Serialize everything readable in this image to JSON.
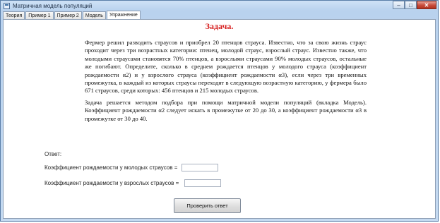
{
  "window": {
    "title": "Матричная модель популяций",
    "minimize_glyph": "–",
    "maximize_glyph": "□",
    "close_glyph": "✕"
  },
  "tabs": [
    {
      "label": "Теория"
    },
    {
      "label": "Пример 1"
    },
    {
      "label": "Пример 2"
    },
    {
      "label": "Модель"
    },
    {
      "label": "Упражнение"
    }
  ],
  "active_tab": "Упражнение",
  "task": {
    "title": "Задача.",
    "paragraph1": "Фермер решил разводить страусов и приобрел 20 птенцов страуса. Известно, что за свою жизнь страус проходит через три возрастных категории: птенец, молодой страус, взрослый страус. Известно также, что молодыми страусами становятся 70% птенцов, а взрослыми страусами 90% молодых страусов, остальные же погибают. Определите, сколько в среднем рождается птенцов у молодого страуса (коэффициент рождаемости α2) и у взрослого страуса (коэффициент рождаемости α3), если через три временных промежутка, в каждый из которых страусы переходят в следующую возрастную категорию, у фермера было 671 страусов, среди которых: 456 птенцов и 215 молодых страусов.",
    "paragraph2": "Задача решается методом подбора при помощи матричной модели популяций (вкладка Модель). Коэффициент рождаемости α2 следует искать в промежутке от 20 до 30, а коэффициент рождаемости α3 в промежутке от 30 до 40."
  },
  "answer": {
    "label": "Ответ:",
    "young_label": "Коэффициент рождаемости у молодых страусов =",
    "young_value": "",
    "adult_label": "Коэффициент рождаемости у взрослых страусов =",
    "adult_value": "",
    "check_button": "Проверить ответ"
  },
  "colors": {
    "title_red": "#d61c1c",
    "frame_blue": "#c5daf1",
    "close_red": "#c74b3a"
  }
}
